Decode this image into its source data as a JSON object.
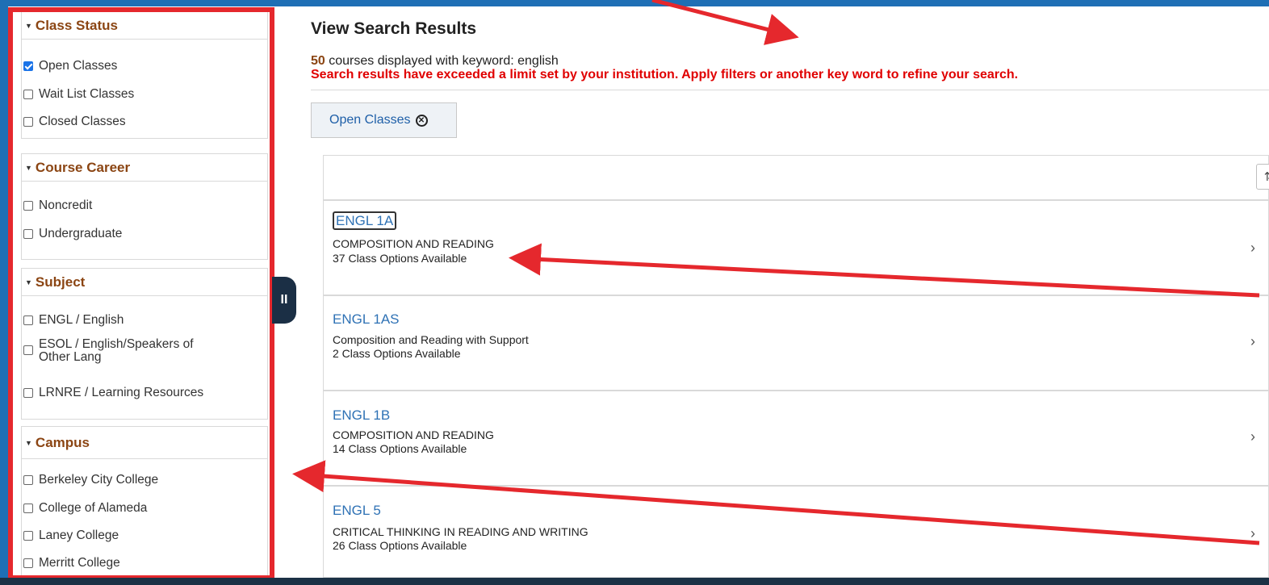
{
  "sidebar": {
    "groups": [
      {
        "title": "Class Status",
        "options": [
          {
            "label": "Open Classes",
            "checked": true
          },
          {
            "label": "Wait List Classes",
            "checked": false
          },
          {
            "label": "Closed Classes",
            "checked": false
          }
        ]
      },
      {
        "title": "Course Career",
        "options": [
          {
            "label": "Noncredit",
            "checked": false
          },
          {
            "label": "Undergraduate",
            "checked": false
          }
        ]
      },
      {
        "title": "Subject",
        "options": [
          {
            "label": "ENGL / English",
            "checked": false
          },
          {
            "label": "ESOL / English/Speakers of Other Lang",
            "checked": false
          },
          {
            "label": "LRNRE / Learning Resources",
            "checked": false
          }
        ]
      },
      {
        "title": "Campus",
        "options": [
          {
            "label": "Berkeley City College",
            "checked": false
          },
          {
            "label": "College of Alameda",
            "checked": false
          },
          {
            "label": "Laney College",
            "checked": false
          },
          {
            "label": "Merritt College",
            "checked": false
          }
        ]
      }
    ],
    "collapse_handle": "II"
  },
  "main": {
    "title": "View Search Results",
    "count": "50",
    "count_text": " courses displayed with keyword: english",
    "warning": "Search results have exceeded a limit set by your institution. Apply filters or another key word to refine your search.",
    "active_filter": "Open Classes",
    "sort_icon": "⇅",
    "courses": [
      {
        "code": "ENGL 1A",
        "title": "COMPOSITION AND READING",
        "availability": "37 Class Options Available"
      },
      {
        "code": "ENGL 1AS",
        "title": "Composition and Reading with Support",
        "availability": "2 Class Options Available"
      },
      {
        "code": "ENGL 1B",
        "title": "COMPOSITION AND READING",
        "availability": "14 Class Options Available"
      },
      {
        "code": "ENGL 5",
        "title": "CRITICAL THINKING IN READING AND WRITING",
        "availability": "26 Class Options Available"
      }
    ]
  },
  "colors": {
    "frame": "#1f6fb5",
    "highlight": "#e5282d",
    "section_heading": "#8b4513",
    "link": "#2f72b5",
    "warning": "#e00000"
  }
}
